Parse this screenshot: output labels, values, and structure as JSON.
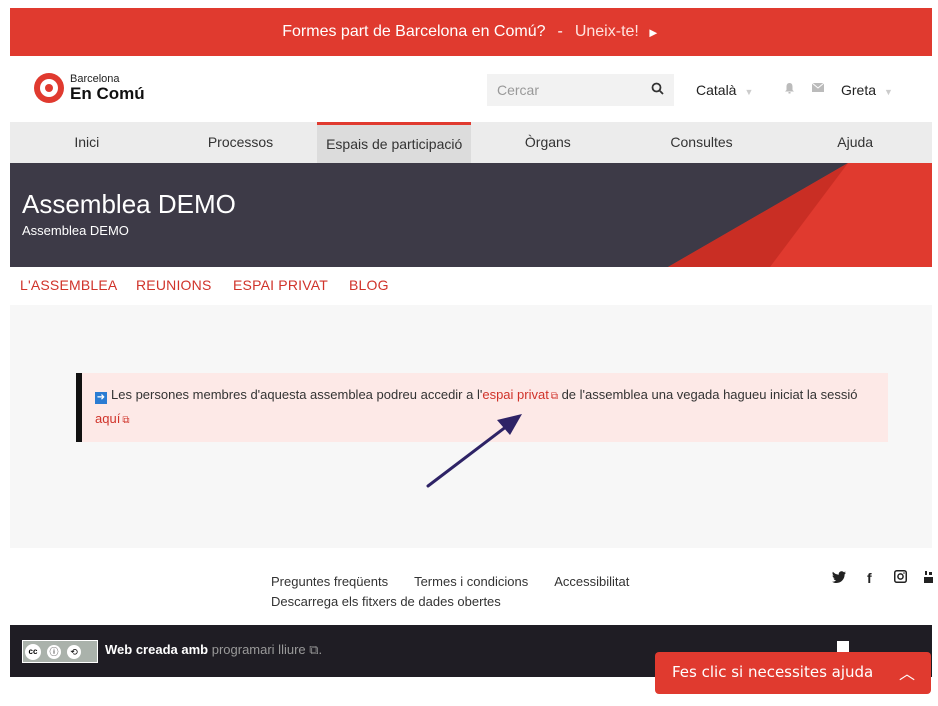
{
  "topbar": {
    "question": "Formes part de Barcelona en Comú?",
    "separator": "-",
    "cta": "Uneix-te!",
    "play_icon": "►"
  },
  "header": {
    "logo": {
      "line1": "Barcelona",
      "line2": "En Comú"
    },
    "search_placeholder": "Cercar",
    "language": "Català",
    "user": "Greta"
  },
  "nav": {
    "items": [
      "Inici",
      "Processos",
      "Espais de participació",
      "Òrgans",
      "Consultes",
      "Ajuda"
    ],
    "active_index": 2
  },
  "hero": {
    "title": "Assemblea DEMO",
    "subtitle": "Assemblea DEMO"
  },
  "subnav": {
    "items": [
      "L'ASSEMBLEA",
      "REUNIONS",
      "ESPAI PRIVAT",
      "BLOG"
    ]
  },
  "callout": {
    "text_before": "Les persones membres d'aquesta assemblea podreu accedir a l'",
    "link1": "espai privat",
    "text_middle": " de l'assemblea una vegada hagueu iniciat la sessió ",
    "link2": "aquí"
  },
  "footer": {
    "links": [
      "Preguntes freqüents",
      "Termes i condicions",
      "Accessibilitat"
    ],
    "open_data": "Descarrega els fitxers de dades obertes",
    "social_icons": [
      "twitter-icon",
      "facebook-icon",
      "instagram-icon",
      "youtube-icon"
    ]
  },
  "bottombar": {
    "made_with": "Web creada amb",
    "libre_link": "programari lliure",
    "license_marks": [
      "BY",
      "SA"
    ]
  },
  "help_button": {
    "label": "Fes clic si necessites ajuda"
  },
  "colors": {
    "brand_red": "#e03a2f",
    "hero_dark": "#3d3a47",
    "footer_dark": "#1f1d24",
    "arrow": "#2e2366"
  }
}
